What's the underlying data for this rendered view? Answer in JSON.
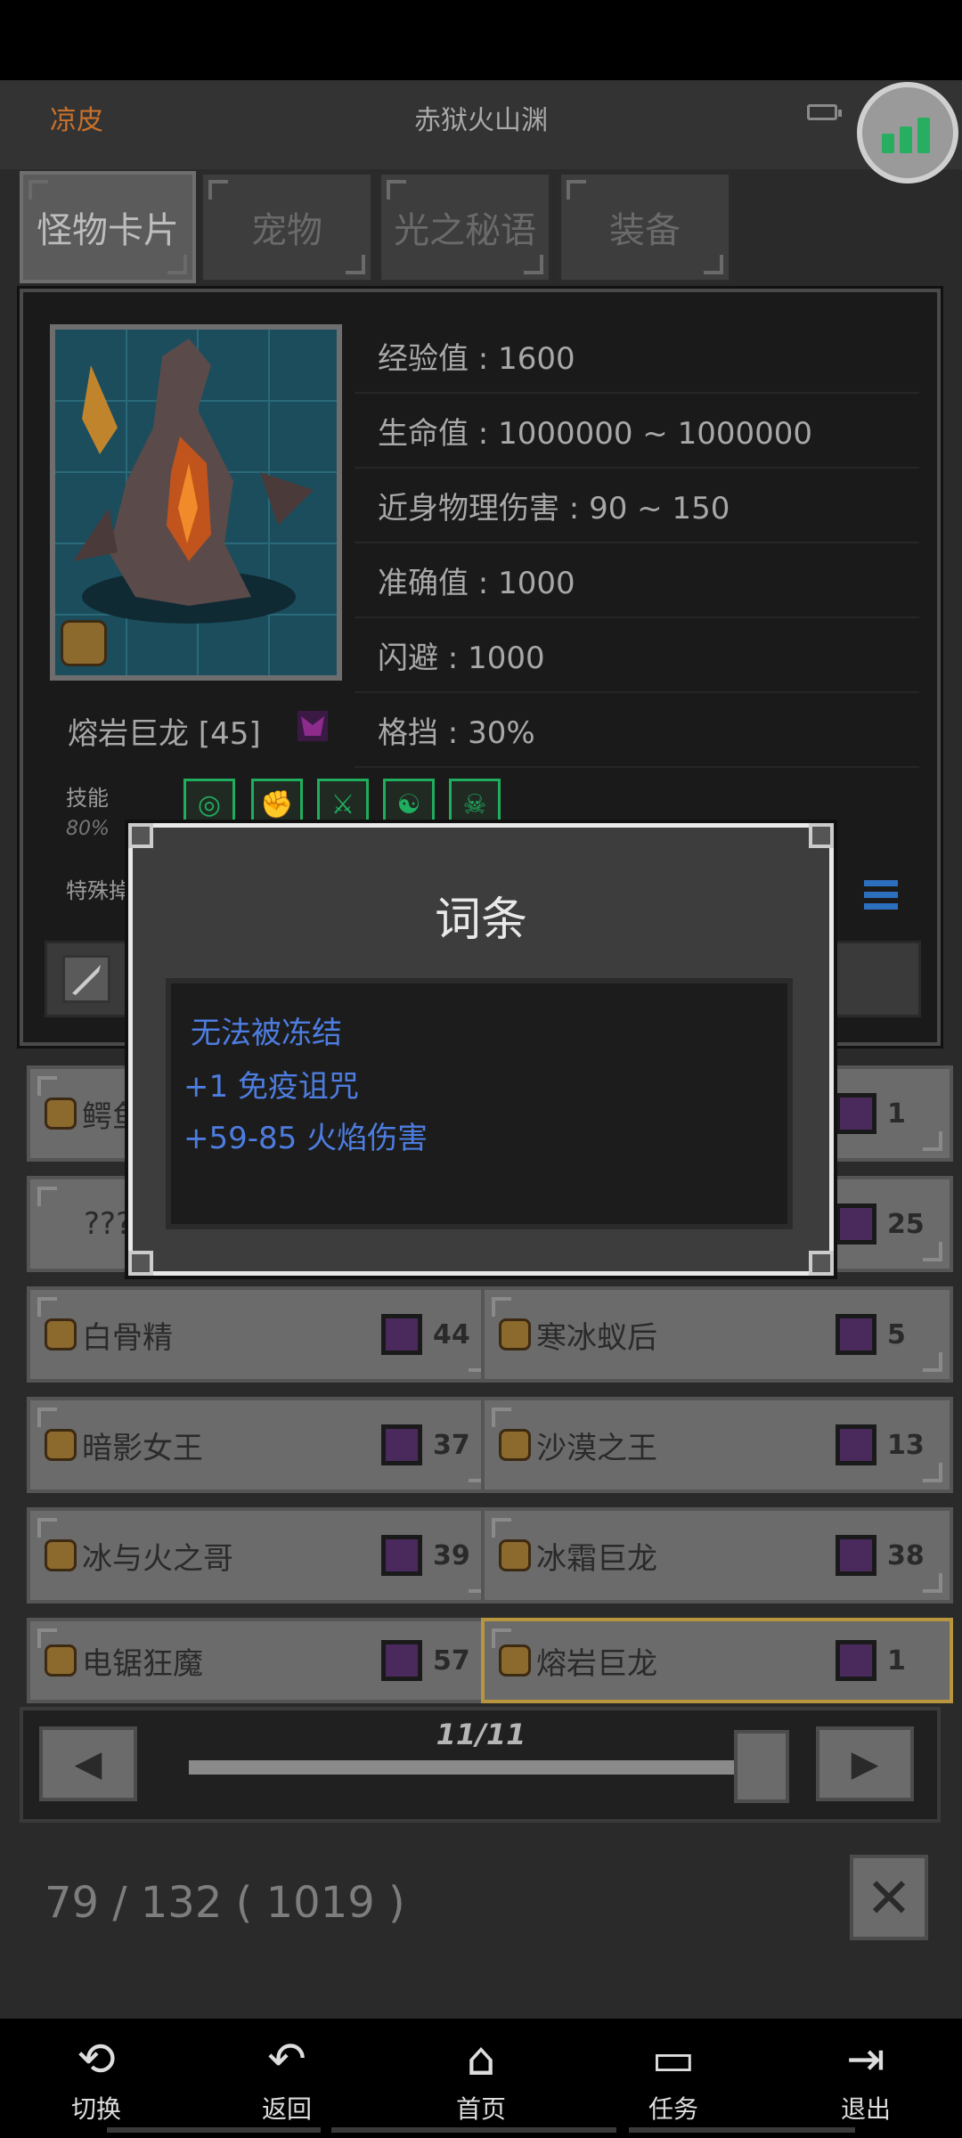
{
  "header": {
    "left_label": "凉皮",
    "map_name": "赤狱火山渊"
  },
  "tabs": [
    {
      "label": "怪物卡片",
      "active": true
    },
    {
      "label": "宠物",
      "active": false
    },
    {
      "label": "光之秘语",
      "active": false
    },
    {
      "label": "装备",
      "active": false
    }
  ],
  "monster": {
    "name": "熔岩巨龙 [45]",
    "stats": [
      "经验值 : 1600",
      "生命值 : 1000000 ~ 1000000",
      "近身物理伤害 : 90 ~ 150",
      "准确值 : 1000",
      "闪避 : 1000",
      "格挡 : 30%"
    ],
    "skills_label": "技能",
    "skills_percent": "80%",
    "special_label": "特殊掉"
  },
  "modal": {
    "title": "词条",
    "affixes": [
      "无法被冻结",
      "+1 免疫诅咒",
      "+59-85 火焰伤害"
    ]
  },
  "cards": [
    {
      "name": "鳄鱼",
      "count": "",
      "right_count": "1"
    },
    {
      "name": "???",
      "count": "",
      "right_count": "25"
    },
    {
      "name": "白骨精",
      "count": "44"
    },
    {
      "name": "寒冰蚁后",
      "count": "5"
    },
    {
      "name": "暗影女王",
      "count": "37"
    },
    {
      "name": "沙漠之王",
      "count": "13"
    },
    {
      "name": "冰与火之哥",
      "count": "39"
    },
    {
      "name": "冰霜巨龙",
      "count": "38"
    },
    {
      "name": "电锯狂魔",
      "count": "57"
    },
    {
      "name": "熔岩巨龙",
      "count": "1"
    }
  ],
  "pager": {
    "page": "11/11"
  },
  "collection": "79 / 132 ( 1019 )",
  "nav": [
    {
      "icon": "switch-icon",
      "label": "切换"
    },
    {
      "icon": "back-icon",
      "label": "返回"
    },
    {
      "icon": "home-icon",
      "label": "首页"
    },
    {
      "icon": "tasks-icon",
      "label": "任务"
    },
    {
      "icon": "exit-icon",
      "label": "退出"
    }
  ],
  "colors": {
    "accent": "#c9712b",
    "affix": "#4d7de0",
    "skill": "#1fae5e",
    "selected": "#b8963e"
  }
}
